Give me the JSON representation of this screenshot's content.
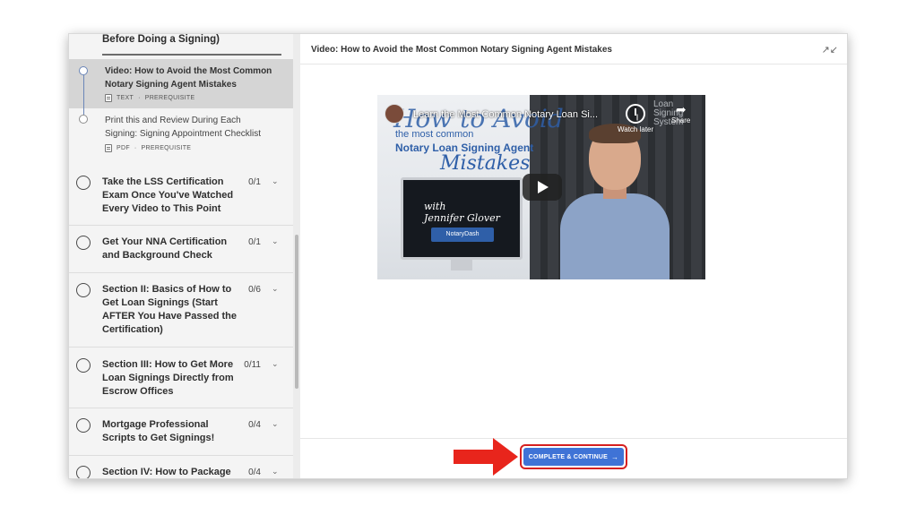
{
  "sidebar": {
    "top_item": "Before Doing a Signing)",
    "lessons": [
      {
        "title": "Video: How to Avoid the Most Common Notary Signing Agent Mistakes",
        "type": "TEXT",
        "tag": "PREREQUISITE",
        "active": true
      },
      {
        "title": "Print this and Review During Each Signing: Signing Appointment Checklist",
        "type": "PDF",
        "tag": "PREREQUISITE",
        "active": false
      }
    ],
    "separator": "·",
    "sections": [
      {
        "title": "Take the LSS Certification Exam Once You've Watched Every Video to This Point",
        "count": "0/1"
      },
      {
        "title": "Get Your NNA Certification and Background Check",
        "count": "0/1"
      },
      {
        "title": "Section II: Basics of How to Get Loan Signings (Start AFTER You Have Passed the Certification)",
        "count": "0/6"
      },
      {
        "title": "Section III: How to Get More Loan Signings Directly from Escrow Offices",
        "count": "0/11"
      },
      {
        "title": "Mortgage Professional Scripts to Get Signings!",
        "count": "0/4"
      },
      {
        "title": "Section IV: How to Package",
        "count": "0/4"
      }
    ],
    "chevron_icon": "chevron-down-icon"
  },
  "main": {
    "title": "Video: How to Avoid the Most Common Notary Signing Agent Mistakes",
    "expand_icon": "expand-icon",
    "video": {
      "youtube_title": "Learn the Most Common Notary Loan Si...",
      "overlay_big": "How to Avoid",
      "overlay_sub": "the most common",
      "overlay_main": "Notary Loan Signing Agent",
      "overlay_mistakes": "Mistakes",
      "with": "with",
      "presenter": "Jennifer Glover",
      "brand": "NotaryDash",
      "watch_later": "Watch later",
      "share": "Share",
      "lss_logo": [
        "Loan",
        "Signing",
        "System"
      ]
    },
    "complete_button": "COMPLETE & CONTINUE",
    "complete_arrow": "→"
  },
  "colors": {
    "accent_blue": "#3f73d6",
    "highlight_red": "#d62020",
    "sidebar_bg": "#f4f4f4",
    "active_lesson_bg": "#d5d5d5"
  }
}
